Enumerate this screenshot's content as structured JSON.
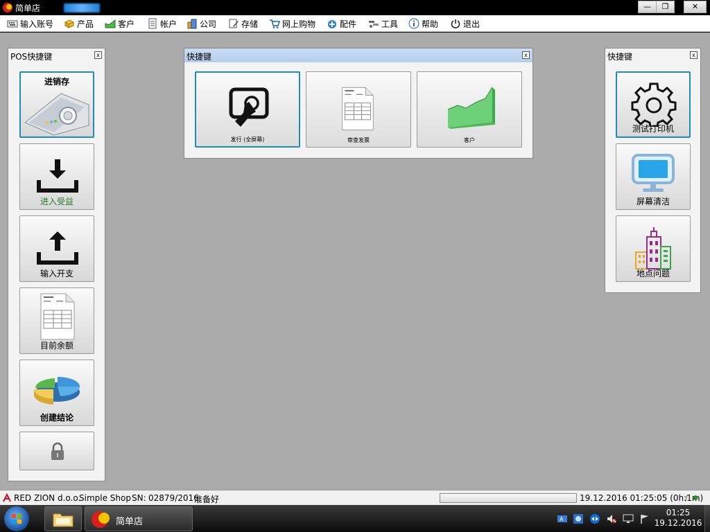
{
  "window": {
    "title": "简单店",
    "minimize": "—",
    "restore": "❐",
    "close": "✕"
  },
  "menu": [
    {
      "label": "输入账号",
      "icon": "keyboard-icon"
    },
    {
      "label": "产品",
      "icon": "box-icon"
    },
    {
      "label": "客户",
      "icon": "chart-icon"
    },
    {
      "label": "帐户",
      "icon": "document-icon"
    },
    {
      "label": "公司",
      "icon": "building-icon"
    },
    {
      "label": "存储",
      "icon": "edit-icon"
    },
    {
      "label": "网上购物",
      "icon": "cart-icon"
    },
    {
      "label": "配件",
      "icon": "plus-cloud-icon"
    },
    {
      "label": "工具",
      "icon": "tools-icon"
    },
    {
      "label": "帮助",
      "icon": "info-icon"
    },
    {
      "label": "退出",
      "icon": "power-icon"
    }
  ],
  "left_panel": {
    "title": "POS快捷键",
    "close": "x",
    "tiles": [
      {
        "label": "进销存",
        "icon": "pos-terminal-icon"
      },
      {
        "label": "进入受益",
        "icon": "download-tray-icon"
      },
      {
        "label": "输入开支",
        "icon": "upload-tray-icon"
      },
      {
        "label": "目前余额",
        "icon": "invoice-icon"
      },
      {
        "label": "创建结论",
        "icon": "pie-chart-icon"
      },
      {
        "label": "",
        "icon": "lock-icon"
      }
    ]
  },
  "center_panel": {
    "title": "快捷键",
    "close": "x",
    "tiles": [
      {
        "label": "发行 (全屏幕)",
        "icon": "touch-screen-icon"
      },
      {
        "label": "审查发票",
        "icon": "invoice-icon"
      },
      {
        "label": "客户",
        "icon": "green-chart-icon"
      }
    ]
  },
  "right_panel": {
    "title": "快捷键",
    "close": "x",
    "tiles": [
      {
        "label": "测试打印机",
        "icon": "gear-icon"
      },
      {
        "label": "屏幕清洁",
        "icon": "monitor-icon"
      },
      {
        "label": "地点问题",
        "icon": "city-buildings-icon"
      }
    ]
  },
  "status": {
    "company": "RED ZION d.o.o.",
    "product": "Simple Shop",
    "sn_label": "SN:",
    "sn": "02879/2016",
    "state": "准备好",
    "datetime": "19.12.2016 01:25:05 (0h:1m)",
    "sep": "/",
    "dot": "●"
  },
  "taskbar": {
    "app_label": "简单店",
    "time": "01:25",
    "date": "19.12.2016"
  },
  "colors": {
    "workspace": "#ababab",
    "active_border": "#1f8bbd",
    "panel_header": "#c9dcf3"
  }
}
